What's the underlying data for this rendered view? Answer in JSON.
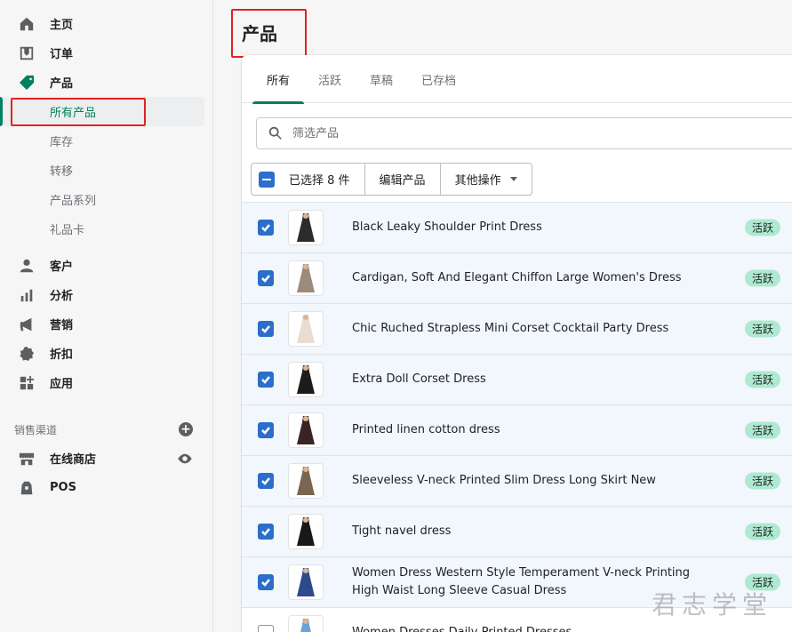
{
  "sidebar": {
    "nav": [
      {
        "label": "主页",
        "icon": "home-icon"
      },
      {
        "label": "订单",
        "icon": "orders-icon"
      },
      {
        "label": "产品",
        "icon": "tag-icon"
      }
    ],
    "products_sub": [
      "所有产品",
      "库存",
      "转移",
      "产品系列",
      "礼品卡"
    ],
    "nav2": [
      {
        "label": "客户",
        "icon": "person-icon"
      },
      {
        "label": "分析",
        "icon": "bar-chart-icon"
      },
      {
        "label": "营销",
        "icon": "megaphone-icon"
      },
      {
        "label": "折扣",
        "icon": "discount-icon"
      },
      {
        "label": "应用",
        "icon": "apps-icon"
      }
    ],
    "sales_channels_label": "销售渠道",
    "channels": [
      {
        "label": "在线商店",
        "icon": "store-icon"
      },
      {
        "label": "POS",
        "icon": "pos-icon"
      }
    ]
  },
  "page": {
    "title": "产品",
    "tabs": [
      "所有",
      "活跃",
      "草稿",
      "已存档"
    ],
    "search_placeholder": "筛选产品",
    "bulk": {
      "selected": "已选择 8 件",
      "edit": "编辑产品",
      "more": "其他操作"
    },
    "products": [
      {
        "name": "Black Leaky Shoulder Print Dress",
        "status": "活跃",
        "checked": true,
        "color": "#2b2b2b"
      },
      {
        "name": "Cardigan, Soft And Elegant Chiffon Large Women's Dress",
        "status": "活跃",
        "checked": true,
        "color": "#9c8a7a"
      },
      {
        "name": "Chic Ruched Strapless Mini Corset Cocktail Party Dress",
        "status": "活跃",
        "checked": true,
        "color": "#e8ddd0"
      },
      {
        "name": "Extra Doll Corset Dress",
        "status": "活跃",
        "checked": true,
        "color": "#1c1c1c"
      },
      {
        "name": "Printed linen cotton dress",
        "status": "活跃",
        "checked": true,
        "color": "#3a2323"
      },
      {
        "name": "Sleeveless V-neck Printed Slim Dress Long Skirt New",
        "status": "活跃",
        "checked": true,
        "color": "#7a6650"
      },
      {
        "name": "Tight navel dress",
        "status": "活跃",
        "checked": true,
        "color": "#181818"
      },
      {
        "name": "Women Dress Western Style Temperament V-neck Printing High Waist Long Sleeve Casual Dress",
        "status": "活跃",
        "checked": true,
        "color": "#2d4a8a"
      },
      {
        "name": "Women Dresses Daily Printed Dresses",
        "status": "",
        "checked": false,
        "color": "#6aa3d8"
      }
    ]
  },
  "watermark": "君志学堂"
}
